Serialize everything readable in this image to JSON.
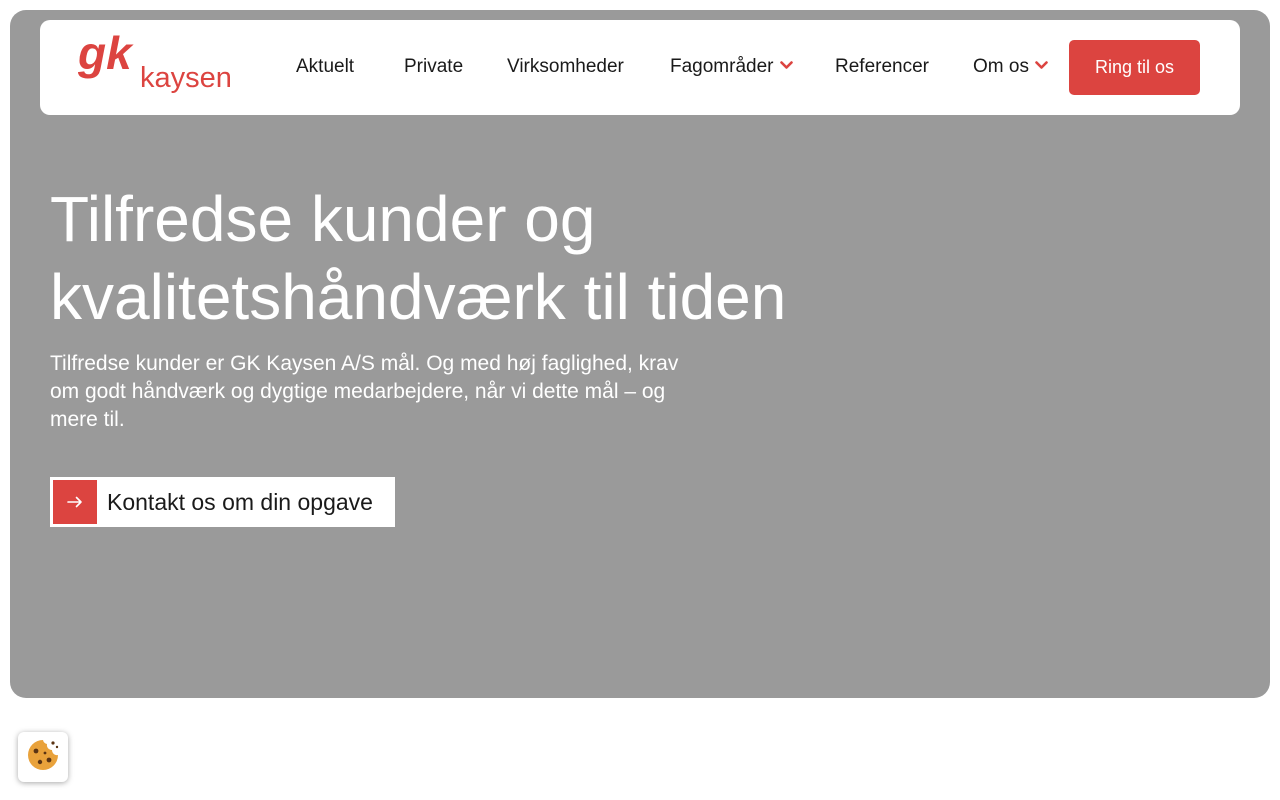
{
  "brand": {
    "logo_text": "gk kaysen",
    "logo_mark": "gk",
    "logo_word": "kaysen",
    "accent_color": "#dc4440"
  },
  "nav": {
    "items": [
      {
        "label": "Aktuelt",
        "has_dropdown": false
      },
      {
        "label": "Private",
        "has_dropdown": false
      },
      {
        "label": "Virksomheder",
        "has_dropdown": false
      },
      {
        "label": "Fagområder",
        "has_dropdown": true
      },
      {
        "label": "Referencer",
        "has_dropdown": false
      },
      {
        "label": "Om os",
        "has_dropdown": true
      }
    ],
    "cta_label": "Ring til os"
  },
  "hero": {
    "headline": "Tilfredse kunder og kvalitetshåndværk til tiden",
    "subtext": "Tilfredse kunder er GK Kaysen A/S mål. Og med høj faglighed, krav om godt håndværk og dygtige medarbejdere, når vi dette mål – og mere til.",
    "contact_button_label": "Kontakt os om din opgave",
    "background_color": "#9a9a9a"
  },
  "icons": {
    "dropdown": "chevron-down-icon",
    "contact": "arrow-right-icon",
    "cookie": "cookie-icon"
  }
}
